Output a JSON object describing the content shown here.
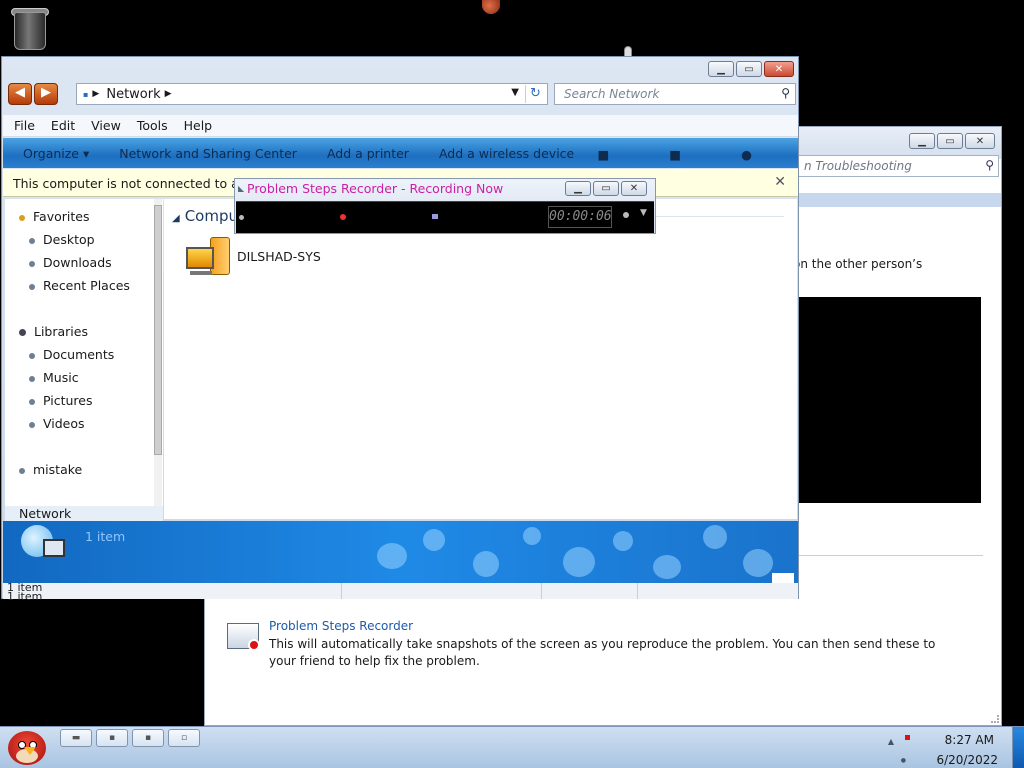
{
  "explorer": {
    "address_path": "Network",
    "search_placeholder": "Search Network",
    "menu": [
      "File",
      "Edit",
      "View",
      "Tools",
      "Help"
    ],
    "toolbar": [
      "Organize ▾",
      "Network and Sharing Center",
      "Add a printer",
      "Add a wireless device"
    ],
    "infobar": "This computer is not connected to a n",
    "nav": {
      "favorites": "Favorites",
      "favorites_items": [
        "Desktop",
        "Downloads",
        "Recent Places"
      ],
      "libraries": "Libraries",
      "libraries_items": [
        "Documents",
        "Music",
        "Pictures",
        "Videos"
      ],
      "mistake": "mistake",
      "network": "Network"
    },
    "group_header": "Compu",
    "items": [
      {
        "name": "DILSHAD-SYS"
      }
    ],
    "details_count": "1 item",
    "status": [
      "1 item",
      "1 item"
    ]
  },
  "troubleshoot": {
    "search_placeholder": "n Troubleshooting",
    "body_text": "on the other person’s",
    "psr_title": "Problem Steps Recorder",
    "psr_desc": "This will automatically take snapshots of the screen as you reproduce the problem. You can then send these to your friend to help fix the problem."
  },
  "recorder": {
    "title": "Problem Steps Recorder - Recording Now",
    "timer": "00:00:06"
  },
  "taskbar": {
    "time": "8:27 AM",
    "date": "6/20/2022"
  },
  "colors": {
    "recorder_title": "#cc1fa3",
    "toolbar_blue": "#1d6fc0",
    "link_blue": "#1e5aa8"
  }
}
